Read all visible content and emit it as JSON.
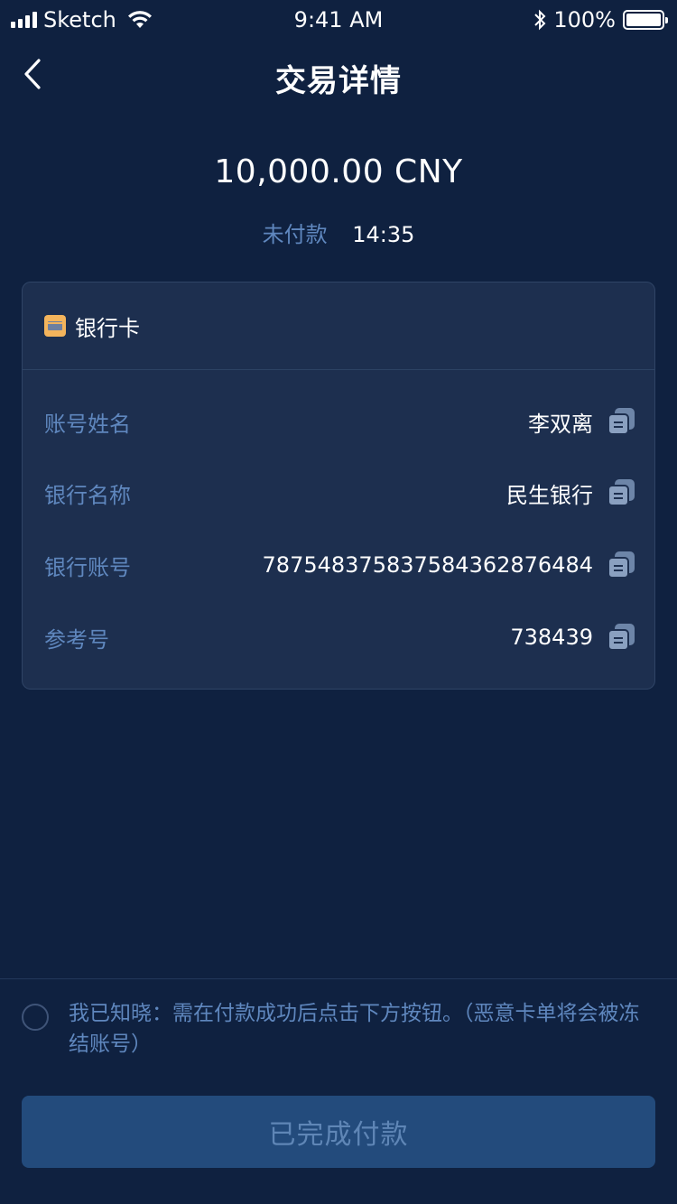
{
  "status_bar": {
    "carrier": "Sketch",
    "time": "9:41 AM",
    "battery": "100%",
    "icons": [
      "signal-icon",
      "wifi-icon",
      "bluetooth-icon",
      "battery-icon"
    ]
  },
  "nav": {
    "back_icon": "chevron-left-icon",
    "title": "交易详情"
  },
  "summary": {
    "amount": "10,000.00 CNY",
    "status": "未付款",
    "countdown": "14:35"
  },
  "card": {
    "icon": "bank-card-icon",
    "title": "银行卡",
    "rows": [
      {
        "label": "账号姓名",
        "value": "李双离"
      },
      {
        "label": "银行名称",
        "value": "民生银行"
      },
      {
        "label": "银行账号",
        "value": "787548375837584362876484"
      },
      {
        "label": "参考号",
        "value": "738439"
      }
    ],
    "copy_icon": "copy-icon"
  },
  "footer": {
    "agree_text": "我已知晓：需在付款成功后点击下方按钮。（恶意卡单将会被冻结账号）",
    "button_label": "已完成付款"
  },
  "colors": {
    "background": "#0f2140",
    "card": "#1d2f4f",
    "muted_text": "#5f87be",
    "button": "#234b7c",
    "bank_icon": "#f3b45c"
  }
}
